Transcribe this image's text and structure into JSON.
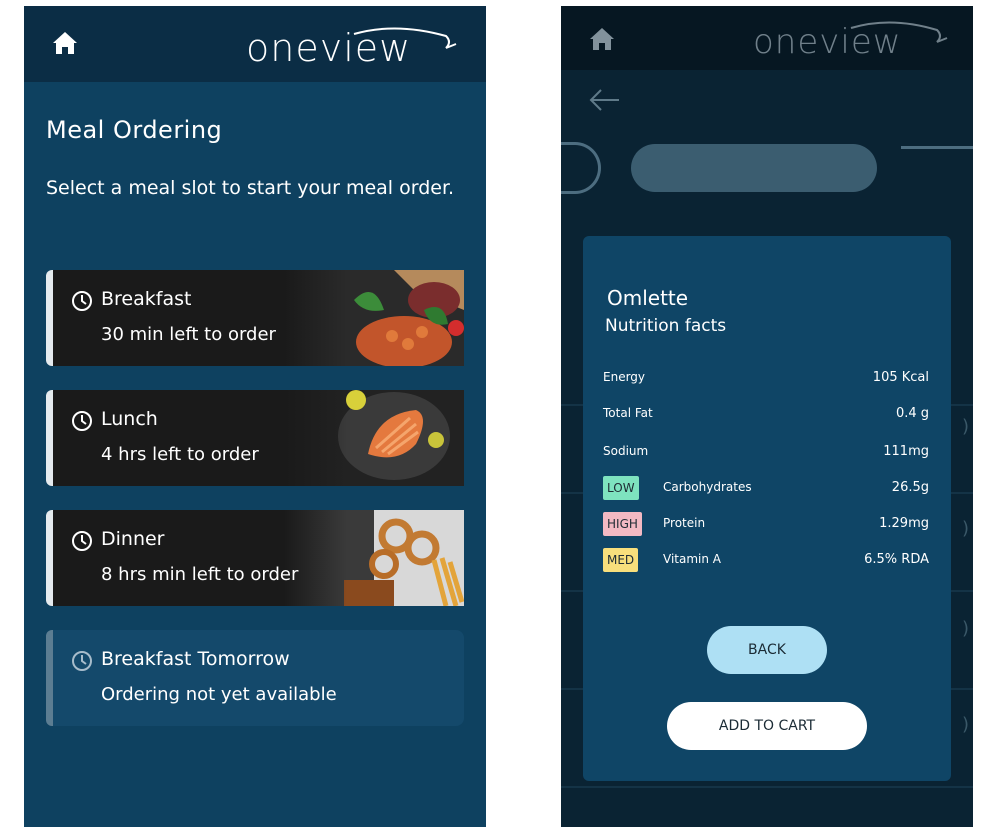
{
  "brand": {
    "logo_text": "oneview"
  },
  "left": {
    "title": "Meal Ordering",
    "subtitle": "Select a meal slot to start your meal order.",
    "meals": [
      {
        "name": "Breakfast",
        "status": "30 min left to order"
      },
      {
        "name": "Lunch",
        "status": "4 hrs left to order"
      },
      {
        "name": "Dinner",
        "status": "8 hrs min left to order"
      },
      {
        "name": "Breakfast Tomorrow",
        "status": "Ordering not yet available"
      }
    ]
  },
  "modal": {
    "item_name": "Omlette",
    "section_title": "Nutrition facts",
    "rows": [
      {
        "label": "Energy",
        "value": "105 Kcal",
        "tag": ""
      },
      {
        "label": "Total Fat",
        "value": "0.4 g",
        "tag": ""
      },
      {
        "label": "Sodium",
        "value": "111mg",
        "tag": ""
      },
      {
        "label": "Carbohydrates",
        "value": "26.5g",
        "tag": "LOW"
      },
      {
        "label": "Protein",
        "value": "1.29mg",
        "tag": "HIGH"
      },
      {
        "label": "Vitamin A",
        "value": "6.5% RDA",
        "tag": "MED"
      }
    ],
    "back_label": "BACK",
    "add_label": "ADD TO CART"
  },
  "colors": {
    "screen_bg": "#0e4160",
    "header_bg": "#0b2d45",
    "modal_bg": "#0f4566",
    "tag_low": "#7ee3bf",
    "tag_high": "#f2b9c3",
    "tag_med": "#f8df7c",
    "back_button": "#aee0f4"
  },
  "icons": [
    "home-icon",
    "clock-icon",
    "back-arrow-icon",
    "chevron-right-icon"
  ]
}
